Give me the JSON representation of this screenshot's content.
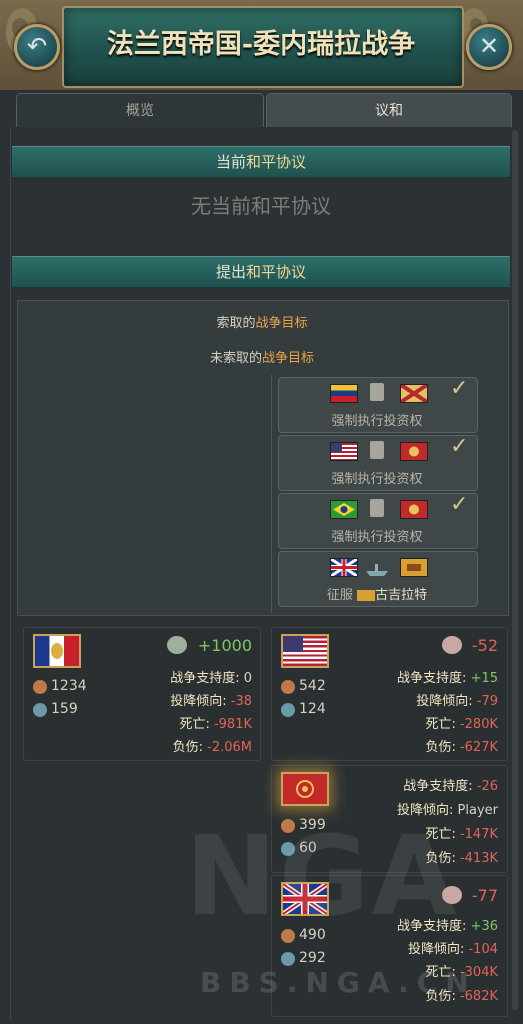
{
  "window": {
    "title": "法兰西帝国-委内瑞拉战争",
    "back_icon": "back-arrow-icon",
    "close_icon": "close-x-icon"
  },
  "tabs": [
    {
      "label": "概览",
      "active": false
    },
    {
      "label": "议和",
      "active": true
    }
  ],
  "current_peace": {
    "header_prefix": "当前",
    "header_highlight": "和平协议",
    "empty_prefix": "无当前",
    "empty_highlight": "和平协议"
  },
  "propose_peace": {
    "header_prefix": "提出",
    "header_highlight": "和平协议",
    "demanded_prefix": "索取的",
    "demanded_highlight": "战争目标",
    "undemanded_prefix": "未索取的",
    "undemanded_highlight": "战争目标"
  },
  "war_goals": [
    {
      "label": "强制执行投资权",
      "checked": true,
      "flag_a": "venezuela",
      "flag_b": "other"
    },
    {
      "label": "强制执行投资权",
      "checked": true,
      "flag_a": "usa",
      "flag_b": "red-state"
    },
    {
      "label": "强制执行投资权",
      "checked": true,
      "flag_a": "brazil",
      "flag_b": "red-state"
    },
    {
      "label_prefix": "征服",
      "label_target": "古吉拉特",
      "checked": false,
      "flag_a": "uk",
      "flag_b": "gujarat"
    }
  ],
  "participants": {
    "france": {
      "score": "+1000",
      "score_icon": "thumbs-up-icon",
      "army": "1234",
      "navy": "159",
      "support_label": "战争支持度:",
      "support_value": "0",
      "surrender_label": "投降倾向:",
      "surrender_value": "-38",
      "deaths_label": "死亡:",
      "deaths_value": "-981K",
      "wounded_label": "负伤:",
      "wounded_value": "-2.06M"
    },
    "usa": {
      "score": "-52",
      "score_icon": "thumbs-down-icon",
      "army": "542",
      "navy": "124",
      "support_label": "战争支持度:",
      "support_value": "+15",
      "surrender_label": "投降倾向:",
      "surrender_value": "-79",
      "deaths_label": "死亡:",
      "deaths_value": "-280K",
      "wounded_label": "负伤:",
      "wounded_value": "-627K"
    },
    "red_state": {
      "army": "399",
      "navy": "60",
      "support_label": "战争支持度:",
      "support_value": "-26",
      "surrender_label": "投降倾向:",
      "surrender_value": "Player",
      "deaths_label": "死亡:",
      "deaths_value": "-147K",
      "wounded_label": "负伤:",
      "wounded_value": "-413K"
    },
    "uk": {
      "score": "-77",
      "score_icon": "thumbs-down-icon",
      "army": "490",
      "navy": "292",
      "support_label": "战争支持度:",
      "support_value": "+36",
      "surrender_label": "投降倾向:",
      "surrender_value": "-104",
      "deaths_label": "死亡:",
      "deaths_value": "-304K",
      "wounded_label": "负伤:",
      "wounded_value": "-682K"
    }
  },
  "watermark": {
    "logo": "NGA",
    "site": "BBS.NGA.CN"
  },
  "colors": {
    "teal_bar": "#2d6e6a",
    "negative": "#e36356",
    "positive": "#7fc66a",
    "gold": "#c9a458"
  }
}
